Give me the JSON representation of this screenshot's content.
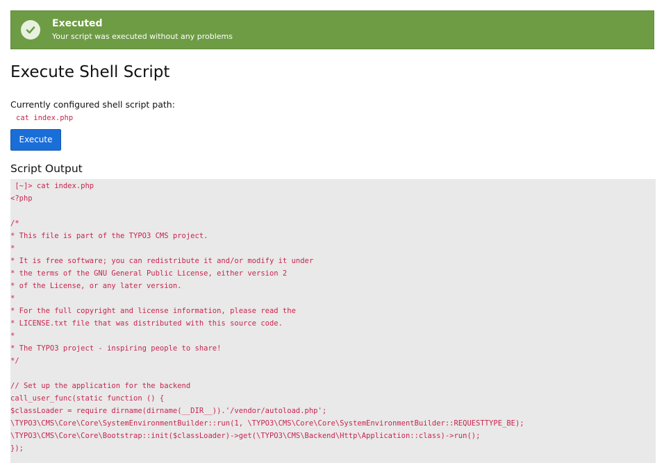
{
  "alert": {
    "title": "Executed",
    "message": "Your script was executed without any problems",
    "icon": "checkmark-icon",
    "color": "#6e9c45"
  },
  "page": {
    "title": "Execute Shell Script"
  },
  "config": {
    "label": "Currently configured shell script path:",
    "path": "cat index.php"
  },
  "actions": {
    "execute_label": "Execute",
    "color": "#1a6ed8"
  },
  "output": {
    "title": "Script Output",
    "text_color": "#c7254e",
    "lines": [
      " [~]> cat index.php",
      "<?php",
      "",
      "/*",
      "* This file is part of the TYPO3 CMS project.",
      "*",
      "* It is free software; you can redistribute it and/or modify it under",
      "* the terms of the GNU General Public License, either version 2",
      "* of the License, or any later version.",
      "*",
      "* For the full copyright and license information, please read the",
      "* LICENSE.txt file that was distributed with this source code.",
      "*",
      "* The TYPO3 project - inspiring people to share!",
      "*/",
      "",
      "// Set up the application for the backend",
      "call_user_func(static function () {",
      "$classLoader = require dirname(dirname(__DIR__)).'/vendor/autoload.php';",
      "\\TYPO3\\CMS\\Core\\Core\\SystemEnvironmentBuilder::run(1, \\TYPO3\\CMS\\Core\\Core\\SystemEnvironmentBuilder::REQUESTTYPE_BE);",
      "\\TYPO3\\CMS\\Core\\Core\\Bootstrap::init($classLoader)->get(\\TYPO3\\CMS\\Backend\\Http\\Application::class)->run();",
      "});"
    ]
  }
}
